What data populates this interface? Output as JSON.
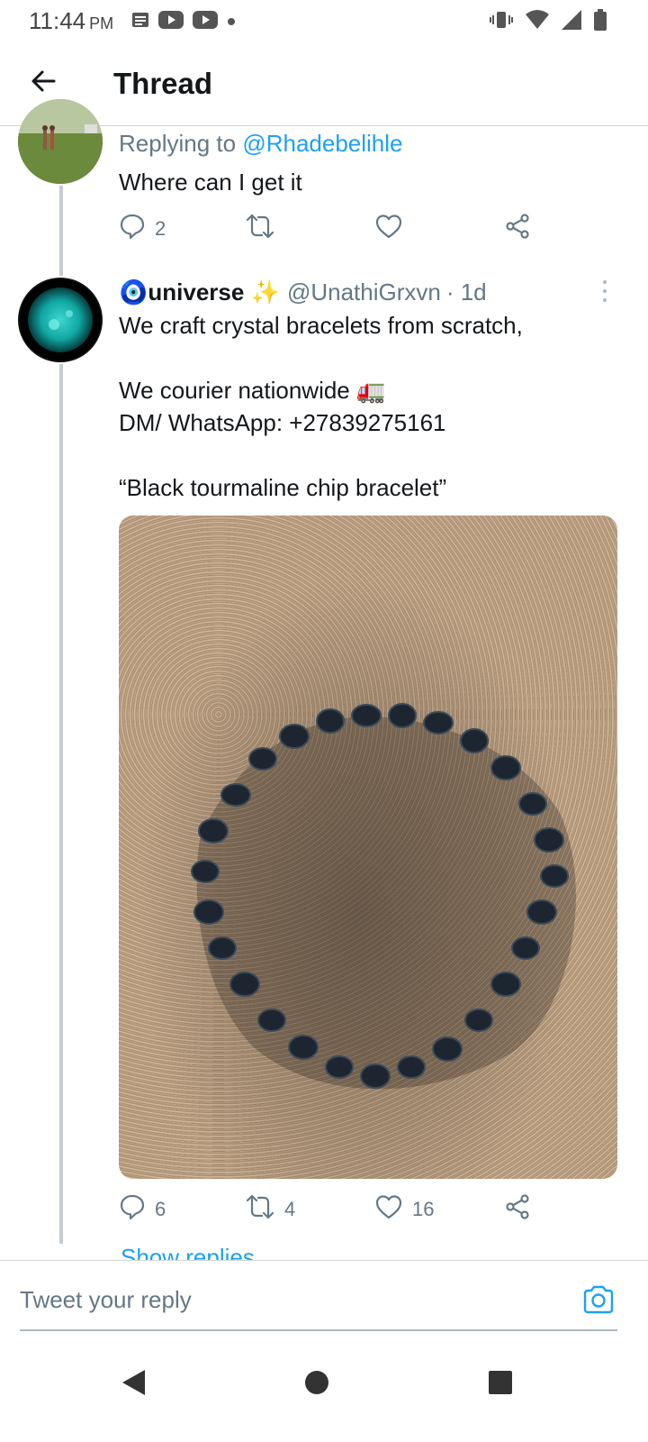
{
  "status_bar": {
    "time": "11:44",
    "ampm": "PM",
    "notification_icons": [
      "news-icon",
      "youtube-icon",
      "youtube-icon",
      "dot-icon"
    ],
    "system_icons": [
      "vibrate-icon",
      "wifi-icon",
      "signal-icon",
      "battery-icon"
    ]
  },
  "app_bar": {
    "title": "Thread"
  },
  "reply_tweet": {
    "replying_prefix": "Replying to",
    "replying_handle": "@Rhadebelihle",
    "text": "Where can I get it",
    "actions": {
      "reply_count": "2",
      "retweet_count": "",
      "like_count": ""
    }
  },
  "main_tweet": {
    "name_emoji": "🧿",
    "name": "universe",
    "name_suffix_emoji": "✨",
    "handle": "@UnathiGrxvn",
    "time": "· 1d",
    "text_lines": [
      "We craft crystal bracelets from scratch,",
      "",
      "We courier nationwide 🚛",
      "DM/ WhatsApp: +27839275161",
      "",
      "“Black tourmaline chip bracelet”"
    ],
    "actions": {
      "reply_count": "6",
      "retweet_count": "4",
      "like_count": "16"
    },
    "show_replies": "Show replies"
  },
  "composer": {
    "placeholder": "Tweet your reply"
  },
  "colors": {
    "accent": "#1da1f2",
    "secondary_text": "#657786",
    "primary_text": "#14171a",
    "thread_line": "#c8ccd1"
  }
}
